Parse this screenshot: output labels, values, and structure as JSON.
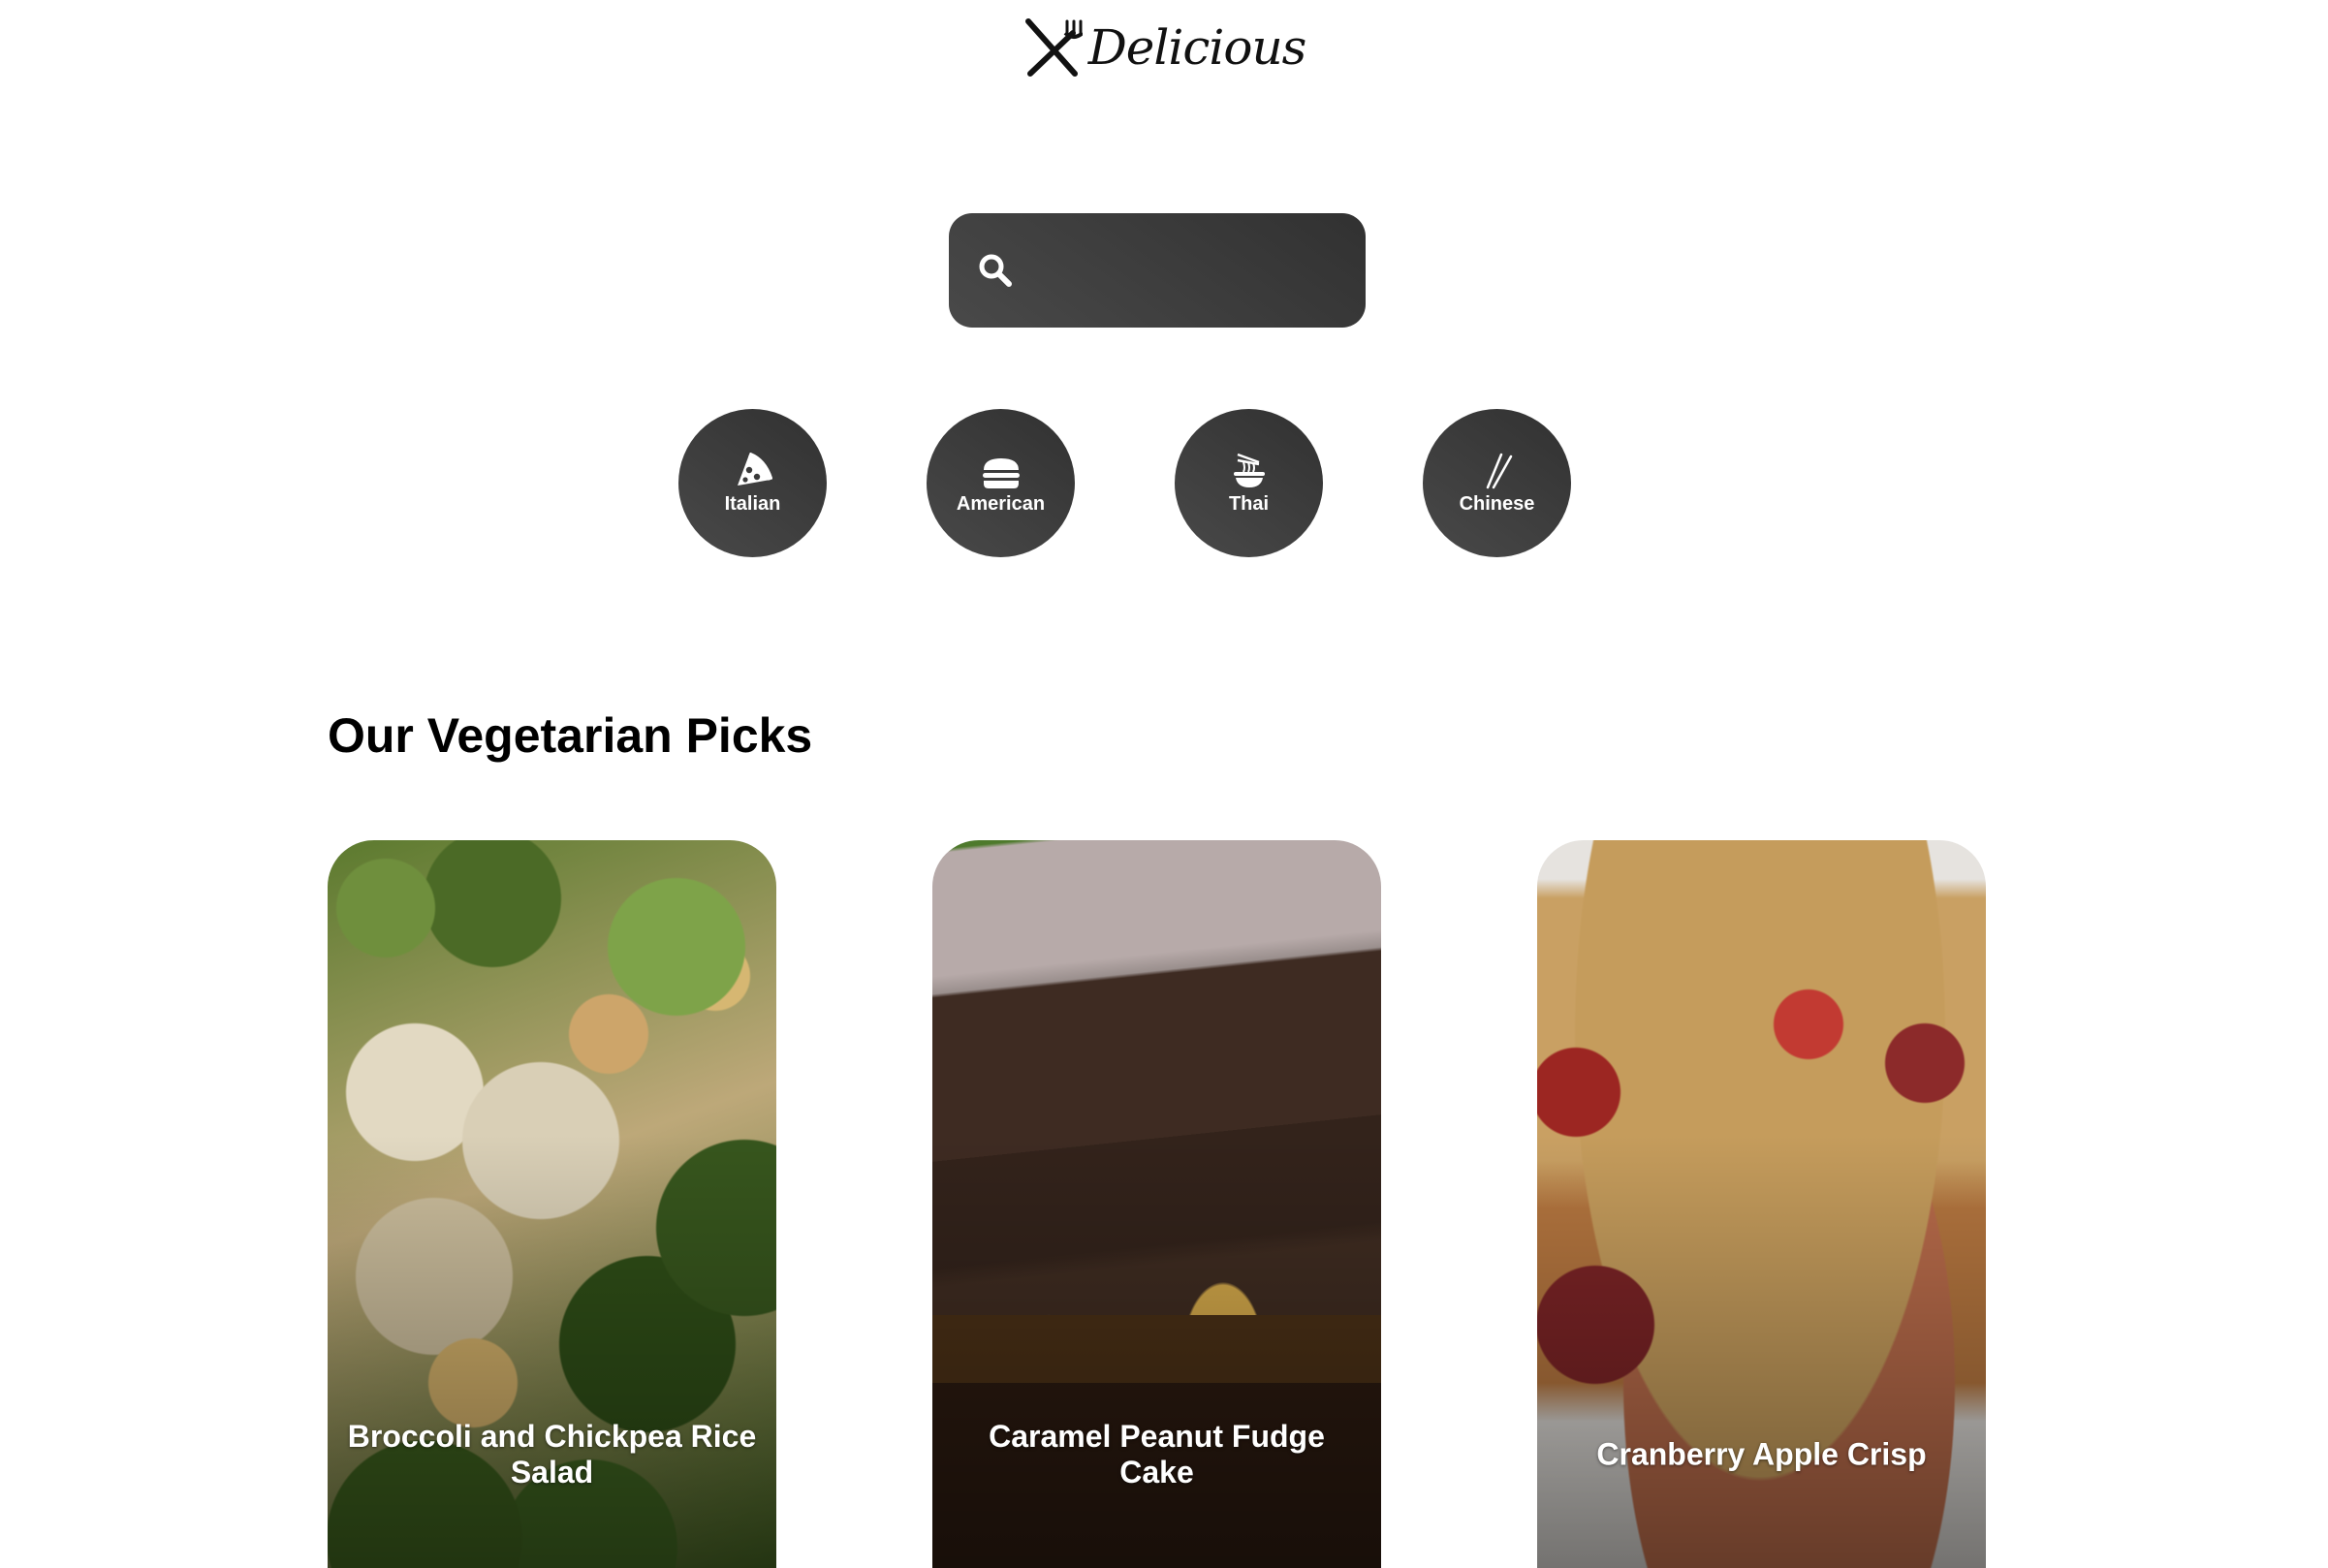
{
  "brand": {
    "name": "Delicious",
    "icon": "fork-knife-icon"
  },
  "search": {
    "icon": "search-icon",
    "value": "",
    "placeholder": ""
  },
  "categories": [
    {
      "label": "Italian",
      "icon": "pizza-icon"
    },
    {
      "label": "American",
      "icon": "hamburger-icon"
    },
    {
      "label": "Thai",
      "icon": "noodle-bowl-icon"
    },
    {
      "label": "Chinese",
      "icon": "chopsticks-icon"
    }
  ],
  "picks": {
    "title": "Our Vegetarian Picks",
    "items": [
      {
        "title": "Broccoli and Chickpea Rice Salad"
      },
      {
        "title": "Caramel Peanut Fudge Cake"
      },
      {
        "title": "Cranberry Apple Crisp"
      }
    ]
  },
  "colors": {
    "button_dark": "#3f3f3f",
    "text_light": "#ffffff",
    "background": "#ffffff"
  }
}
